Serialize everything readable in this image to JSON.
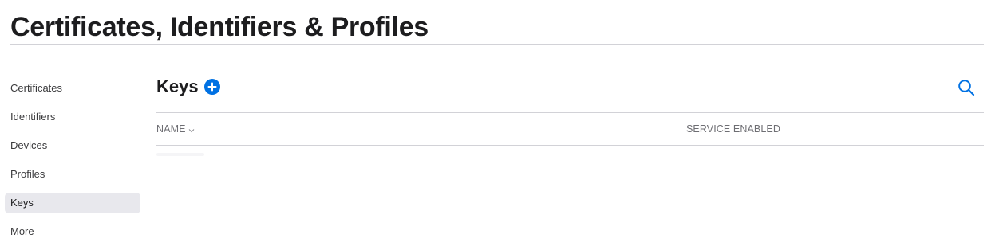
{
  "page": {
    "title": "Certificates, Identifiers & Profiles"
  },
  "sidebar": {
    "items": [
      {
        "label": "Certificates",
        "active": false
      },
      {
        "label": "Identifiers",
        "active": false
      },
      {
        "label": "Devices",
        "active": false
      },
      {
        "label": "Profiles",
        "active": false
      },
      {
        "label": "Keys",
        "active": true
      },
      {
        "label": "More",
        "active": false
      }
    ]
  },
  "main": {
    "section_title": "Keys",
    "add_icon": "plus-circle-icon",
    "search_icon": "search-icon",
    "table": {
      "columns": [
        {
          "label": "NAME",
          "sort_icon": "chevron-down-icon"
        },
        {
          "label": "SERVICE ENABLED"
        }
      ],
      "rows": []
    }
  },
  "colors": {
    "accent": "#0071e3",
    "text": "#1d1d1f",
    "secondary_text": "#6e6e73",
    "active_item_bg": "#e8e8ed",
    "divider": "#d2d2d7"
  }
}
